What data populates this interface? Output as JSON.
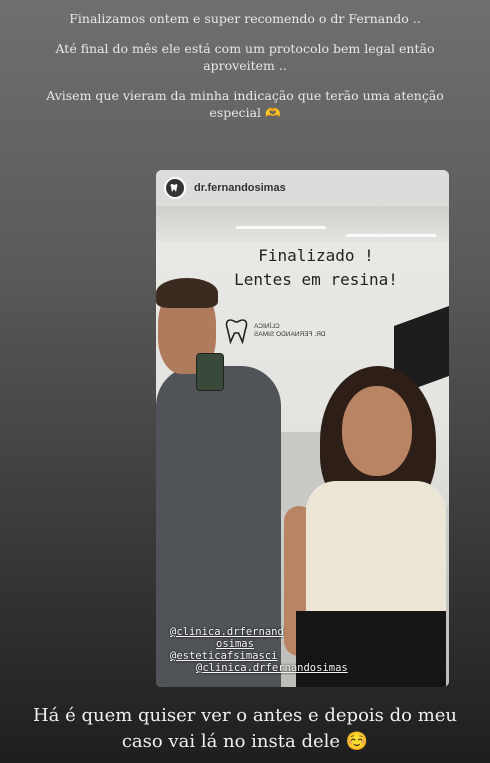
{
  "caption_top": {
    "line1": "Finalizamos ontem e super recomendo o dr Fernando ..",
    "line2": "Até final do mês ele está com um protocolo bem legal então aproveitem ..",
    "line3": "Avisem que vieram da minha indicação que terão uma atenção especial 🫶"
  },
  "shared_post": {
    "username": "dr.fernandosimas",
    "wall_text_line1": "Finalizado !",
    "wall_text_line2": "Lentes em resina!",
    "clinic_logo_line1": "CLÍNICA",
    "clinic_logo_line2": "DR. FERNANDO SIMAS",
    "tags": [
      "@clinica.drfernand",
      "osimas",
      "@esteticafsimasci",
      "@clinica.drfernandosimas"
    ]
  },
  "caption_bottom": "Há é quem quiser ver o antes e depois do meu caso vai lá no insta dele ☺️",
  "colors": {
    "background_top": "#6f6f6f",
    "background_bottom": "#1e1e1e",
    "text": "#f2f2f2"
  }
}
